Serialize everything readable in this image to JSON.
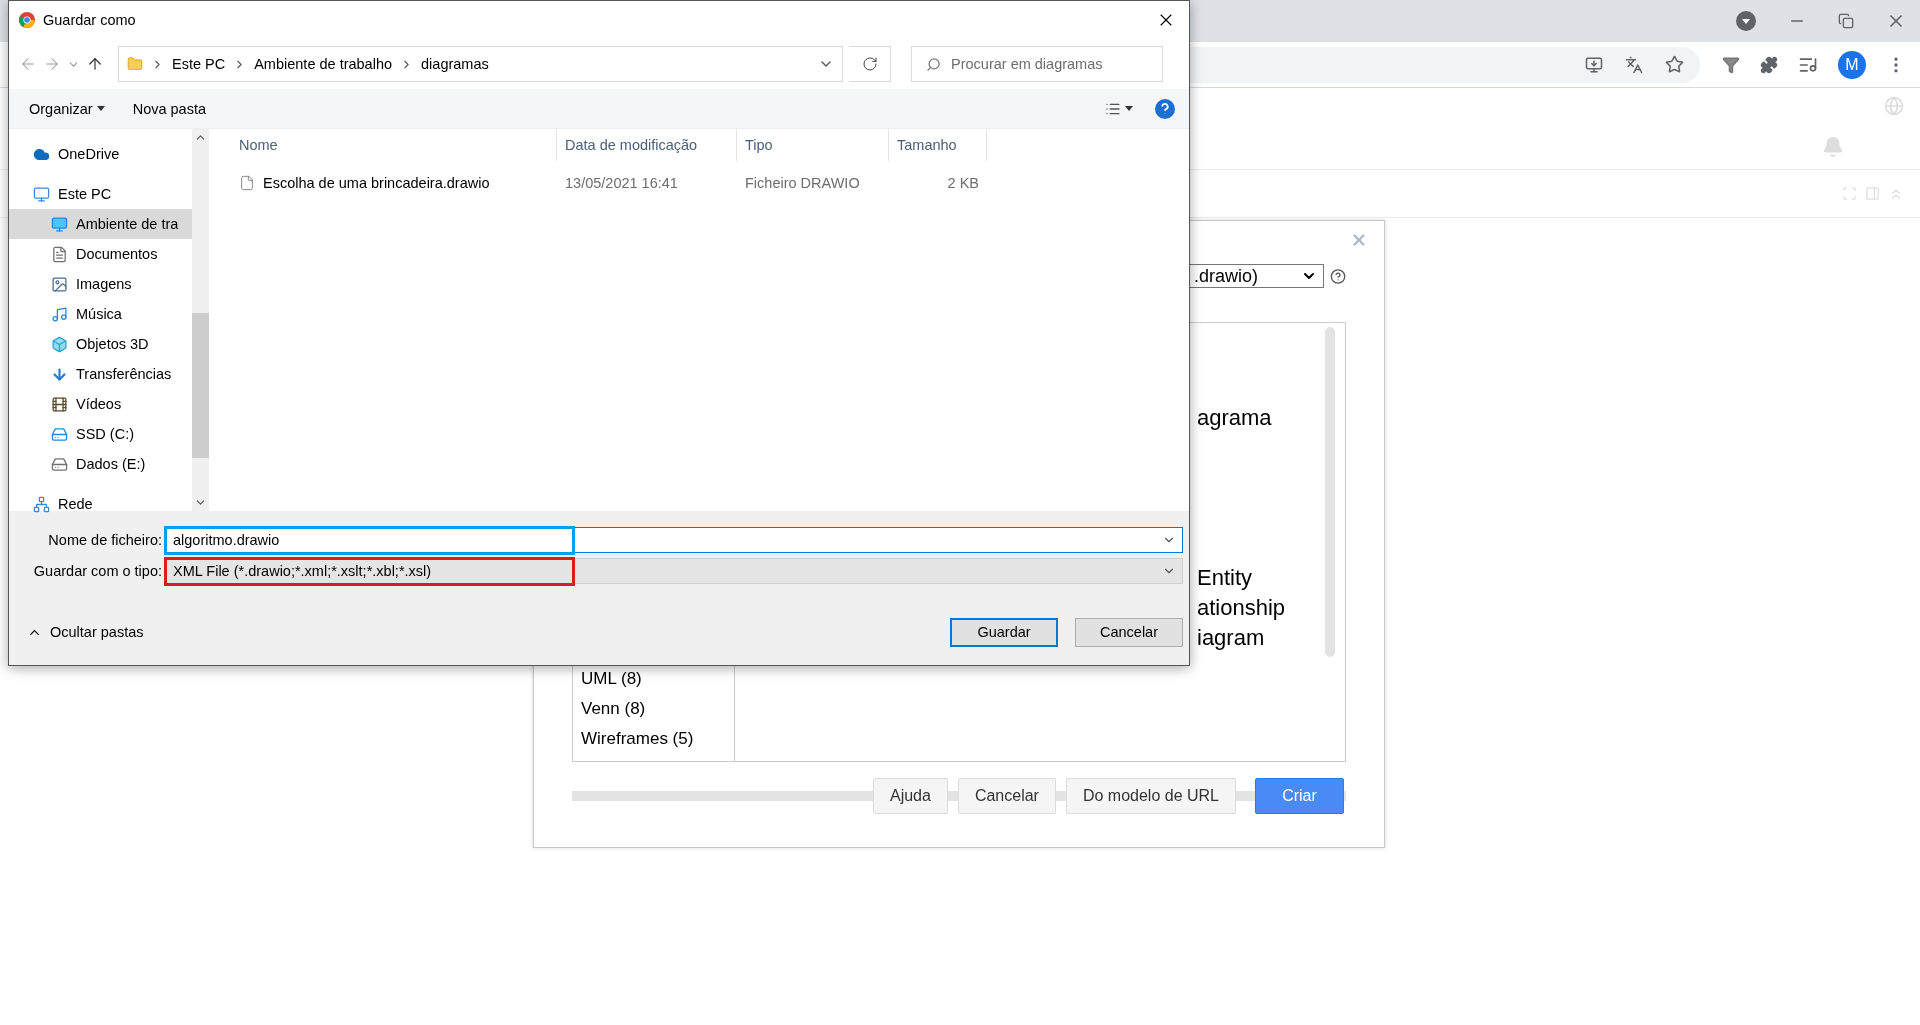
{
  "browser": {
    "profile_initial": "M"
  },
  "drawio_dialog": {
    "format_select": ".drawio)",
    "template_titles": [
      {
        "lines": [
          "agrama"
        ]
      },
      {
        "lines": [
          "Entity",
          "ationship",
          "iagram"
        ]
      }
    ],
    "categories": [
      "UML (8)",
      "Venn (8)",
      "Wireframes (5)"
    ],
    "buttons": [
      {
        "label": "Ajuda",
        "kind": "normal"
      },
      {
        "label": "Cancelar",
        "kind": "normal"
      },
      {
        "label": "Do modelo de URL",
        "kind": "normal"
      },
      {
        "label": "Criar",
        "kind": "primary"
      }
    ]
  },
  "save_dialog": {
    "title": "Guardar como",
    "breadcrumb": [
      "Este PC",
      "Ambiente de trabalho",
      "diagramas"
    ],
    "search": {
      "placeholder": "Procurar em diagramas"
    },
    "toolbar": [
      {
        "label": "Organizar",
        "dropdown": true
      },
      {
        "label": "Nova pasta",
        "dropdown": false
      }
    ],
    "nav": [
      {
        "label": "OneDrive",
        "kind": "cloud",
        "selected": false
      },
      {
        "label": "Este PC",
        "kind": "pc",
        "selected": false,
        "children": [
          {
            "label": "Ambiente de tra",
            "kind": "desktop",
            "selected": true
          },
          {
            "label": "Documentos",
            "kind": "documents",
            "selected": false
          },
          {
            "label": "Imagens",
            "kind": "pictures",
            "selected": false
          },
          {
            "label": "Música",
            "kind": "music",
            "selected": false
          },
          {
            "label": "Objetos 3D",
            "kind": "objects",
            "selected": false
          },
          {
            "label": "Transferências",
            "kind": "downloads",
            "selected": false
          },
          {
            "label": "Vídeos",
            "kind": "videos",
            "selected": false
          },
          {
            "label": "SSD (C:)",
            "kind": "system",
            "selected": false
          },
          {
            "label": "Dados (E:)",
            "kind": "drive",
            "selected": false
          }
        ]
      },
      {
        "label": "Rede",
        "kind": "network",
        "selected": false
      }
    ],
    "columns": [
      "Nome",
      "Data de modificação",
      "Tipo",
      "Tamanho"
    ],
    "rows": [
      {
        "name": "Escolha de uma brincadeira.drawio",
        "date": "13/05/2021 16:41",
        "type": "Ficheiro DRAWIO",
        "size": "2 KB"
      }
    ],
    "filename": {
      "label": "Nome de ficheiro:",
      "value": "algoritmo.drawio"
    },
    "filetype": {
      "label": "Guardar com o tipo:",
      "value": "XML File (*.drawio;*.xml;*.xslt;*.xbl;*.xsl)"
    },
    "hide_folders": "Ocultar pastas",
    "buttons": [
      {
        "label": "Guardar",
        "kind": "primary"
      },
      {
        "label": "Cancelar",
        "kind": "normal"
      }
    ]
  }
}
